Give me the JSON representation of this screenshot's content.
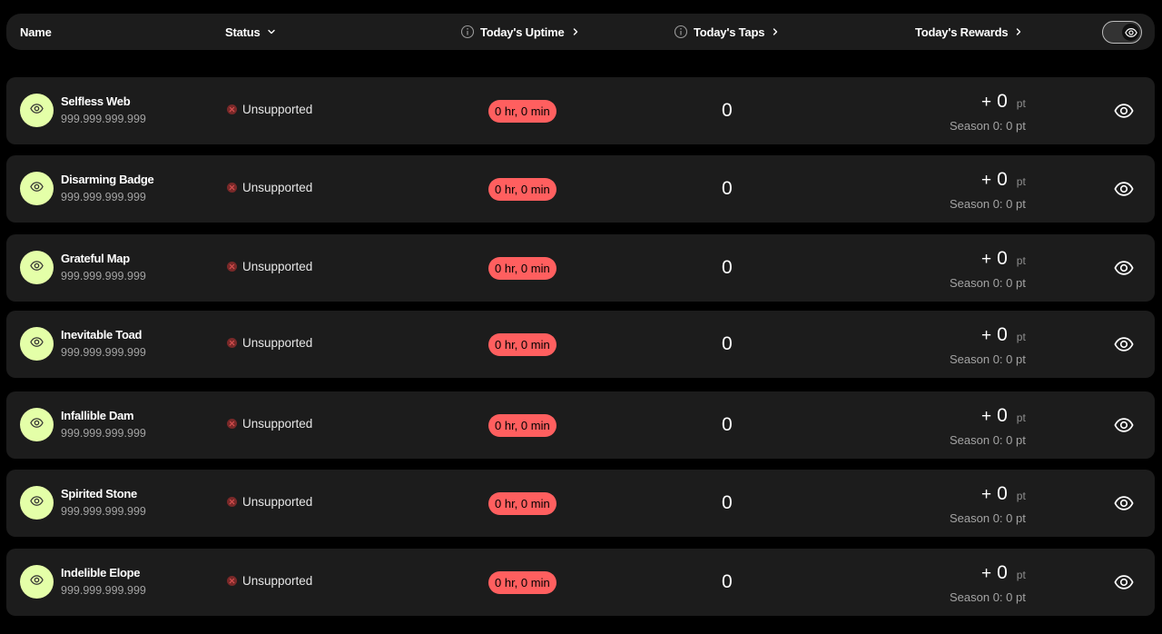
{
  "header": {
    "name": "Name",
    "status": "Status",
    "uptime": "Today's Uptime",
    "taps": "Today's Taps",
    "rewards": "Today's Rewards",
    "toggle_icon": "eye-icon"
  },
  "colors": {
    "background": "#000000",
    "card": "#1c1c1c",
    "avatar": "#e4ffa8",
    "uptime_pill": "#ff5f5f",
    "status_error": "#e05555"
  },
  "rows": [
    {
      "name": "Selfless Web",
      "ip": "999.999.999.999",
      "status": "Unsupported",
      "uptime": "0 hr, 0 min",
      "taps": "0",
      "reward_plus": "+",
      "reward_value": "0",
      "reward_unit": "pt",
      "season": "Season 0: 0 pt"
    },
    {
      "name": "Disarming Badge",
      "ip": "999.999.999.999",
      "status": "Unsupported",
      "uptime": "0 hr, 0 min",
      "taps": "0",
      "reward_plus": "+",
      "reward_value": "0",
      "reward_unit": "pt",
      "season": "Season 0: 0 pt"
    },
    {
      "name": "Grateful Map",
      "ip": "999.999.999.999",
      "status": "Unsupported",
      "uptime": "0 hr, 0 min",
      "taps": "0",
      "reward_plus": "+",
      "reward_value": "0",
      "reward_unit": "pt",
      "season": "Season 0: 0 pt"
    },
    {
      "name": "Inevitable Toad",
      "ip": "999.999.999.999",
      "status": "Unsupported",
      "uptime": "0 hr, 0 min",
      "taps": "0",
      "reward_plus": "+",
      "reward_value": "0",
      "reward_unit": "pt",
      "season": "Season 0: 0 pt"
    },
    {
      "name": "Infallible Dam",
      "ip": "999.999.999.999",
      "status": "Unsupported",
      "uptime": "0 hr, 0 min",
      "taps": "0",
      "reward_plus": "+",
      "reward_value": "0",
      "reward_unit": "pt",
      "season": "Season 0: 0 pt"
    },
    {
      "name": "Spirited Stone",
      "ip": "999.999.999.999",
      "status": "Unsupported",
      "uptime": "0 hr, 0 min",
      "taps": "0",
      "reward_plus": "+",
      "reward_value": "0",
      "reward_unit": "pt",
      "season": "Season 0: 0 pt"
    },
    {
      "name": "Indelible Elope",
      "ip": "999.999.999.999",
      "status": "Unsupported",
      "uptime": "0 hr, 0 min",
      "taps": "0",
      "reward_plus": "+",
      "reward_value": "0",
      "reward_unit": "pt",
      "season": "Season 0: 0 pt"
    }
  ]
}
